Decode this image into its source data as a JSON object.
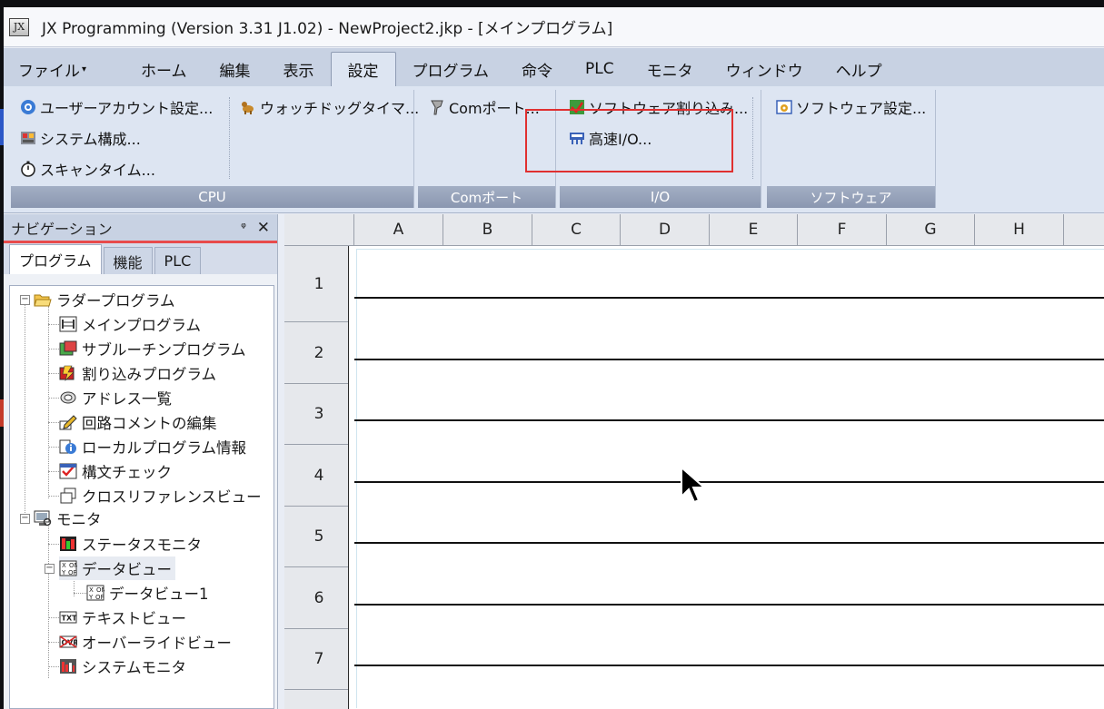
{
  "window": {
    "title": "JX Programming (Version 3.31 J1.02) - NewProject2.jkp - [メインプログラム]",
    "app_icon_text": "JX"
  },
  "menu": {
    "items": [
      "ファイル",
      "ホーム",
      "編集",
      "表示",
      "設定",
      "プログラム",
      "命令",
      "PLC",
      "モニタ",
      "ウィンドウ",
      "ヘルプ"
    ],
    "active": "設定"
  },
  "ribbon": {
    "groups": {
      "cpu": {
        "label": "CPU",
        "user_account": "ユーザーアカウント設定...",
        "system_config": "システム構成...",
        "scan_time": "スキャンタイム...",
        "watchdog": "ウォッチドッグタイマ..."
      },
      "com": {
        "label": "Comポート",
        "com_port": "Comポート..."
      },
      "io": {
        "label": "I/O",
        "software_interrupt": "ソフトウェア割り込み...",
        "high_speed_io": "高速I/O..."
      },
      "software": {
        "label": "ソフトウェア",
        "software_settings": "ソフトウェア設定..."
      }
    }
  },
  "navigation": {
    "title": "ナビゲーション",
    "pin_icon": "pin-icon",
    "close_icon": "close-icon",
    "tabs": [
      "プログラム",
      "機能",
      "PLC"
    ],
    "active_tab": "プログラム",
    "tree": {
      "ladder_root": "ラダープログラム",
      "ladder_items": [
        "メインプログラム",
        "サブルーチンプログラム",
        "割り込みプログラム",
        "アドレス一覧",
        "回路コメントの編集",
        "ローカルプログラム情報",
        "構文チェック",
        "クロスリファレンスビュー"
      ],
      "monitor_root": "モニタ",
      "status_monitor": "ステータスモニタ",
      "data_view": "データビュー",
      "data_view_1": "データビュー1",
      "text_view": "テキストビュー",
      "override_view": "オーバーライドビュー",
      "system_monitor": "システムモニタ"
    }
  },
  "ladder": {
    "columns": [
      "A",
      "B",
      "C",
      "D",
      "E",
      "F",
      "G",
      "H"
    ],
    "rows": [
      "1",
      "2",
      "3",
      "4",
      "5",
      "6",
      "7"
    ]
  }
}
